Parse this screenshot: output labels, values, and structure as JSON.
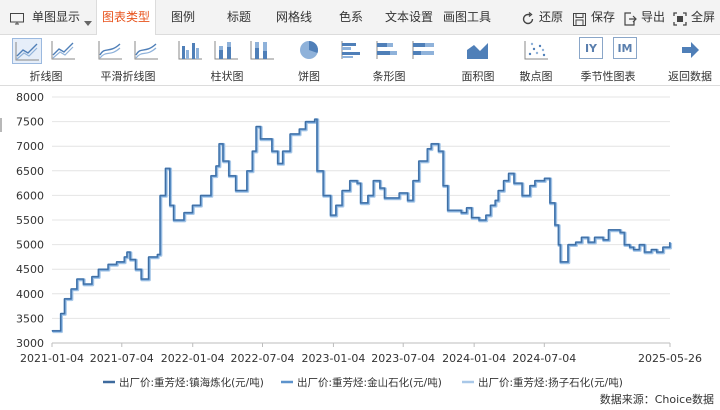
{
  "menu": {
    "single_view": "单图显示",
    "chart_type": "图表类型",
    "legend": "图例",
    "title": "标题",
    "gridline": "网格线",
    "color": "色系",
    "text_settings": "文本设置",
    "drawing_tools": "画图工具",
    "restore": "还原",
    "save": "保存",
    "export": "导出",
    "fullscreen": "全屏"
  },
  "ribbon": {
    "line": "折线图",
    "smooth_line": "平滑折线图",
    "column": "柱状图",
    "pie": "饼图",
    "bar": "条形图",
    "area": "面积图",
    "scatter": "散点图",
    "seasonal": "季节性图表",
    "seasonal_iy": "IY",
    "seasonal_im": "IM",
    "back": "返回数据"
  },
  "colors": {
    "accent": "#e8541e",
    "series1": "#3e6b9e",
    "series2": "#5d93cc",
    "series3": "#a9c8e8"
  },
  "chart_data": {
    "type": "line",
    "ylim": [
      3000,
      8000
    ],
    "yticks": [
      "8000",
      "7500",
      "7000",
      "6500",
      "6000",
      "5500",
      "5000",
      "4500",
      "4000",
      "3500",
      "3000"
    ],
    "xticks": [
      "2021-01-04",
      "2021-07-04",
      "2022-01-04",
      "2022-07-04",
      "2023-01-04",
      "2023-07-04",
      "2024-01-04",
      "2024-07-04",
      "2025-05-26"
    ],
    "x_range": [
      "2021-01-04",
      "2025-05-26"
    ],
    "grid": "horizontal",
    "legend_position": "bottom",
    "series": [
      {
        "name": "出厂价:重芳烃:镇海炼化(元/吨)"
      },
      {
        "name": "出厂价:重芳烃:金山石化(元/吨)"
      },
      {
        "name": "出厂价:重芳烃:扬子石化(元/吨)"
      }
    ],
    "points": [
      [
        "2021-01-04",
        3250
      ],
      [
        "2021-01-22",
        3250
      ],
      [
        "2021-01-27",
        3600
      ],
      [
        "2021-02-06",
        3900
      ],
      [
        "2021-02-23",
        4100
      ],
      [
        "2021-03-10",
        4300
      ],
      [
        "2021-03-27",
        4200
      ],
      [
        "2021-04-18",
        4350
      ],
      [
        "2021-05-05",
        4500
      ],
      [
        "2021-05-30",
        4600
      ],
      [
        "2021-06-21",
        4650
      ],
      [
        "2021-07-11",
        4750
      ],
      [
        "2021-07-18",
        4850
      ],
      [
        "2021-07-26",
        4700
      ],
      [
        "2021-08-09",
        4500
      ],
      [
        "2021-08-24",
        4300
      ],
      [
        "2021-09-12",
        4750
      ],
      [
        "2021-10-05",
        4800
      ],
      [
        "2021-10-12",
        6000
      ],
      [
        "2021-10-26",
        6550
      ],
      [
        "2021-11-06",
        5800
      ],
      [
        "2021-11-16",
        5500
      ],
      [
        "2021-12-13",
        5650
      ],
      [
        "2022-01-04",
        5800
      ],
      [
        "2022-01-25",
        6000
      ],
      [
        "2022-02-21",
        6400
      ],
      [
        "2022-03-06",
        6600
      ],
      [
        "2022-03-14",
        7050
      ],
      [
        "2022-03-24",
        6700
      ],
      [
        "2022-04-08",
        6400
      ],
      [
        "2022-04-26",
        6100
      ],
      [
        "2022-05-25",
        6500
      ],
      [
        "2022-06-08",
        6900
      ],
      [
        "2022-06-18",
        7400
      ],
      [
        "2022-06-29",
        7150
      ],
      [
        "2022-07-29",
        6900
      ],
      [
        "2022-08-13",
        6650
      ],
      [
        "2022-08-26",
        6900
      ],
      [
        "2022-09-14",
        7250
      ],
      [
        "2022-10-08",
        7350
      ],
      [
        "2022-10-24",
        7500
      ],
      [
        "2022-11-17",
        7550
      ],
      [
        "2022-11-23",
        6500
      ],
      [
        "2022-12-09",
        6000
      ],
      [
        "2022-12-28",
        5600
      ],
      [
        "2023-01-11",
        5800
      ],
      [
        "2023-01-27",
        6100
      ],
      [
        "2023-02-16",
        6300
      ],
      [
        "2023-03-07",
        6250
      ],
      [
        "2023-03-16",
        5850
      ],
      [
        "2023-04-04",
        6000
      ],
      [
        "2023-04-18",
        6300
      ],
      [
        "2023-05-05",
        6150
      ],
      [
        "2023-05-17",
        5950
      ],
      [
        "2023-06-24",
        6050
      ],
      [
        "2023-07-16",
        5900
      ],
      [
        "2023-07-30",
        6300
      ],
      [
        "2023-08-14",
        6700
      ],
      [
        "2023-09-05",
        6950
      ],
      [
        "2023-09-15",
        7050
      ],
      [
        "2023-10-04",
        6900
      ],
      [
        "2023-10-16",
        6200
      ],
      [
        "2023-10-28",
        5700
      ],
      [
        "2023-12-02",
        5650
      ],
      [
        "2023-12-16",
        5750
      ],
      [
        "2023-12-29",
        5550
      ],
      [
        "2024-01-17",
        5500
      ],
      [
        "2024-02-04",
        5600
      ],
      [
        "2024-02-16",
        5800
      ],
      [
        "2024-02-28",
        5900
      ],
      [
        "2024-03-07",
        6100
      ],
      [
        "2024-03-21",
        6300
      ],
      [
        "2024-04-03",
        6450
      ],
      [
        "2024-04-17",
        6250
      ],
      [
        "2024-05-08",
        6000
      ],
      [
        "2024-05-28",
        6200
      ],
      [
        "2024-06-10",
        6300
      ],
      [
        "2024-07-05",
        6350
      ],
      [
        "2024-07-19",
        5850
      ],
      [
        "2024-08-01",
        5400
      ],
      [
        "2024-08-10",
        5000
      ],
      [
        "2024-08-15",
        4650
      ],
      [
        "2024-09-04",
        5000
      ],
      [
        "2024-09-24",
        5050
      ],
      [
        "2024-10-09",
        5150
      ],
      [
        "2024-10-26",
        5050
      ],
      [
        "2024-11-12",
        5150
      ],
      [
        "2024-12-04",
        5100
      ],
      [
        "2024-12-18",
        5300
      ],
      [
        "2025-01-17",
        5250
      ],
      [
        "2025-01-28",
        5000
      ],
      [
        "2025-02-11",
        4950
      ],
      [
        "2025-02-21",
        4900
      ],
      [
        "2025-03-08",
        5000
      ],
      [
        "2025-03-21",
        4850
      ],
      [
        "2025-04-08",
        4900
      ],
      [
        "2025-04-22",
        4850
      ],
      [
        "2025-05-08",
        4950
      ],
      [
        "2025-05-26",
        5050
      ]
    ]
  },
  "source": "数据来源：Choice数据"
}
